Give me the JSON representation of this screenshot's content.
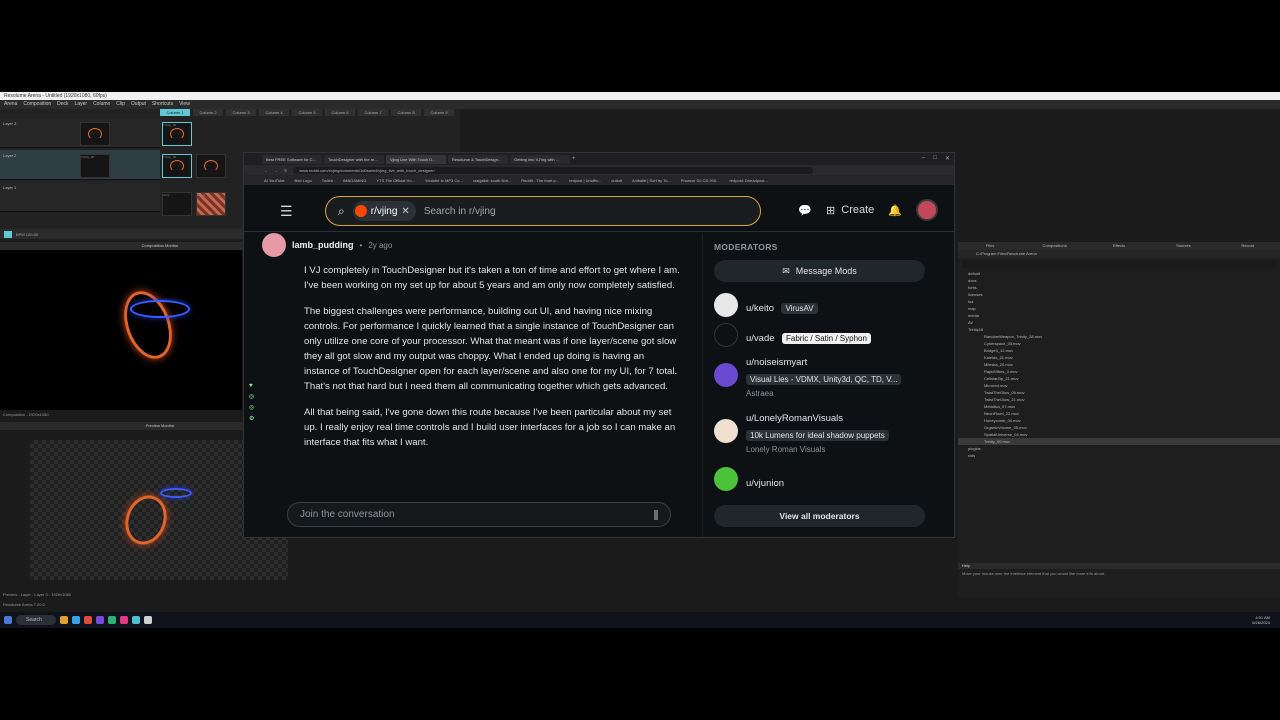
{
  "resolume": {
    "title": "Resolume Arena - Untitled (1920x1080, 60fps)",
    "menu": [
      "Arena",
      "Composition",
      "Deck",
      "Layer",
      "Column",
      "Clip",
      "Output",
      "Shortcuts",
      "View"
    ],
    "columns": [
      "Column 1",
      "Column 2",
      "Column 3",
      "Column 4",
      "Column 5",
      "Column 6",
      "Column 7",
      "Column 8",
      "Column 9"
    ],
    "layers": [
      "Layer 3",
      "Layer 2",
      "Layer 1"
    ],
    "clips": [
      "Trinity_00",
      "Trinity_00",
      "Trinity_00",
      "emiy",
      "empty"
    ],
    "bpm": "BPM 120.00",
    "composition_monitor_title": "Composition Monitor",
    "composition_status": "Composition - 1920x1080",
    "preview_monitor_title": "Preview Monitor",
    "preview_status": "Preview - Layer - Layer 3 - 1920x1080",
    "status_bar": "Resolume Arena 7.20.0"
  },
  "files_panel": {
    "tabs": [
      "Files",
      "Compositions",
      "Effects",
      "Sources",
      "Record"
    ],
    "path": "C:\\Program Files\\Resolume Arena",
    "tree": [
      "default",
      "docs",
      "fonts",
      "licenses",
      "lua",
      "map",
      "media",
      "AV",
      "Trinity18"
    ],
    "files": [
      "RandomWeapon_Trinity_28.mov",
      "Cyberspace_03.mov",
      "Bridge3_12.mov",
      "Kaleido_21.mov",
      "Mileska_20.mov",
      "RapidVibes_3.mov",
      "CellularZip_21.mov",
      "Mirrored.mov",
      "TwistTheGlow_06.mov",
      "TwistTheGlow_21.mov",
      "Metallica_07.mov",
      "NeonFlood_22.mov",
      "Honeycomb_04.mov",
      "OrganicVolume_05.mov",
      "SpatialUniverse_04.mov",
      "Trinity_00.mov"
    ],
    "more_tree": [
      "plugins",
      "vids"
    ],
    "help_title": "Help",
    "help_text": "Move your mouse over the interface element that you would like more info about."
  },
  "taskbar": {
    "search_label": "Search",
    "time": "4:01 AM",
    "date": "6/26/2024"
  },
  "browser": {
    "tabs": [
      "Best FREE Software for C...",
      "TouchDesigner with the re...",
      "Vjing Live With Touch D...",
      "Resolume & TouchDesign...",
      "Getting into VJ'ing with ..."
    ],
    "url": "www.reddit.com/r/vjing/comments/1d0swm4/vjing_live_with_touch_designer/",
    "bookmarks": [
      "AI YouTube",
      "Bob Logo",
      "Twitch",
      "IMAGAMING",
      "YTS The Official Ho...",
      "Youtube to MP3 Co...",
      "craigslist: south flori...",
      "Reddit - The front p...",
      "redpost | Unoffic...",
      "cutsdt",
      "Anibalitt | Sort by To...",
      "Prowcor DJ CD 200...",
      "redpost: Dheadpost..."
    ]
  },
  "reddit": {
    "subreddit_chip": "r/vjing",
    "search_placeholder": "Search in r/vjing",
    "create_label": "Create",
    "post": {
      "username": "lamb_pudding",
      "separator": "•",
      "time": "2y ago",
      "paragraphs": [
        "I VJ completely in TouchDesigner but it's taken a ton of time and effort to get where I am. I've been working on my set up for about 5 years and am only now completely satisfied.",
        "The biggest challenges were performance, building out UI, and having nice mixing controls. For performance I quickly learned that a single instance of TouchDesigner can only utilize one core of your processor. What that meant was if one layer/scene got slow they all got slow and my output was choppy. What I ended up doing is having an instance of TouchDesigner open for each layer/scene and also one for my UI, for 7 total. That's not that hard but I need them all communicating together which gets advanced.",
        "All that being said, I've gone down this route because I've been particular about my set up. I really enjoy real time controls and I build user interfaces for a job so I can make an interface that fits what I want."
      ]
    },
    "join_placeholder": "Join the conversation",
    "moderators": {
      "title": "MODERATORS",
      "message_button": "Message Mods",
      "list": [
        {
          "name": "u/keito",
          "flair": "VirusAV",
          "sub": ""
        },
        {
          "name": "u/vade",
          "flair": "Fabric / Satin / Syphon",
          "sub": ""
        },
        {
          "name": "u/noiseismyart",
          "flair": "Visual Lies - VDMX, Unity3d, QC, TD, V...",
          "sub": "Astraea"
        },
        {
          "name": "u/LonelyRomanVisuals",
          "flair": "10k Lumens for ideal shadow puppets",
          "sub": "Lonely Roman Visuals"
        },
        {
          "name": "u/vjunion",
          "flair": "",
          "sub": ""
        }
      ],
      "view_all": "View all moderators"
    }
  },
  "colors": {
    "reddit_bg": "#0e1113",
    "search_border": "#d9a441",
    "resolume_accent": "#5fc9d6",
    "glow_orange": "#e0652a"
  }
}
